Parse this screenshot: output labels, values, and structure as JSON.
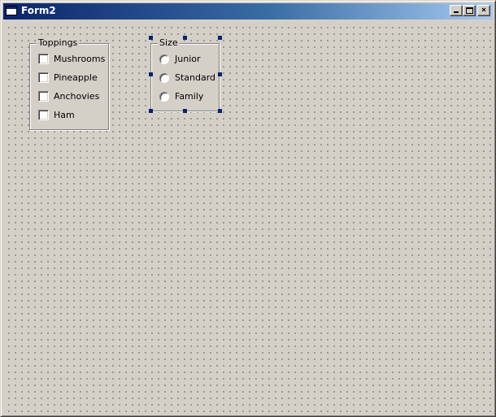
{
  "window": {
    "title": "Form2",
    "buttons": {
      "minimize": "minimize",
      "maximize": "maximize",
      "close": "×"
    }
  },
  "toppings": {
    "label": "Toppings",
    "items": [
      {
        "label": "Mushrooms",
        "checked": false
      },
      {
        "label": "Pineapple",
        "checked": false
      },
      {
        "label": "Anchovies",
        "checked": false
      },
      {
        "label": "Ham",
        "checked": false
      }
    ]
  },
  "size": {
    "label": "Size",
    "selected": true,
    "items": [
      {
        "label": "Junior",
        "checked": false
      },
      {
        "label": "Standard",
        "checked": false
      },
      {
        "label": "Family",
        "checked": false
      }
    ]
  },
  "colors": {
    "titlebar_start": "#0a246a",
    "titlebar_end": "#a6caf0",
    "face": "#d4d0c8",
    "selection_handle": "#0a246a"
  }
}
